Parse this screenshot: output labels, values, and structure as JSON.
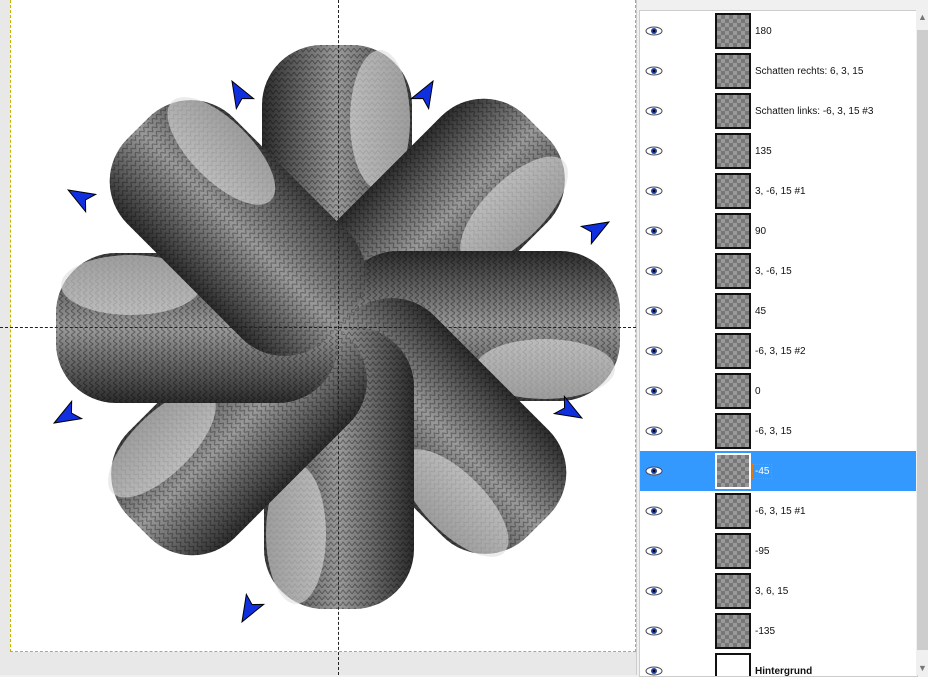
{
  "layers": [
    {
      "name": "180",
      "visible": true,
      "selected": false
    },
    {
      "name": "Schatten rechts: 6, 3, 15",
      "visible": true,
      "selected": false
    },
    {
      "name": "Schatten links: -6, 3, 15 #3",
      "visible": true,
      "selected": false
    },
    {
      "name": "135",
      "visible": true,
      "selected": false
    },
    {
      "name": "3, -6, 15 #1",
      "visible": true,
      "selected": false
    },
    {
      "name": "90",
      "visible": true,
      "selected": false
    },
    {
      "name": "3, -6, 15",
      "visible": true,
      "selected": false
    },
    {
      "name": "45",
      "visible": true,
      "selected": false
    },
    {
      "name": "-6, 3, 15 #2",
      "visible": true,
      "selected": false
    },
    {
      "name": "0",
      "visible": true,
      "selected": false
    },
    {
      "name": "-6, 3, 15",
      "visible": true,
      "selected": false
    },
    {
      "name": "-45",
      "visible": true,
      "selected": true
    },
    {
      "name": "-6, 3, 15 #1",
      "visible": true,
      "selected": false
    },
    {
      "name": "-95",
      "visible": true,
      "selected": false
    },
    {
      "name": "3, 6, 15",
      "visible": true,
      "selected": false
    },
    {
      "name": "-135",
      "visible": true,
      "selected": false
    },
    {
      "name": "Hintergrund",
      "visible": true,
      "selected": false
    }
  ],
  "colors": {
    "selection": "#3399ff",
    "cursor": "#1030e0"
  }
}
